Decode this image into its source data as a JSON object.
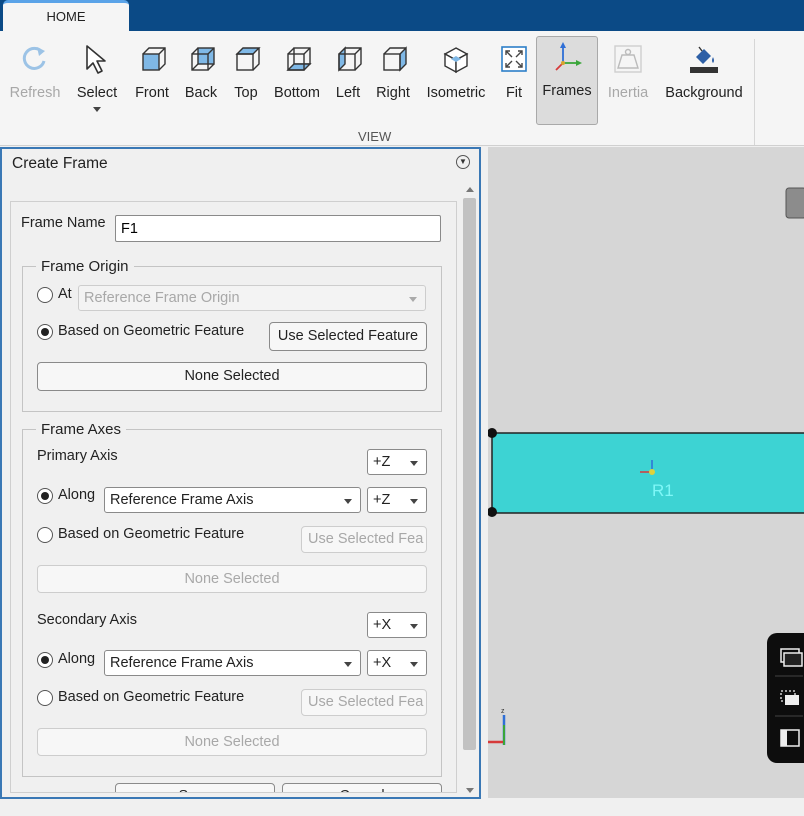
{
  "tabs": {
    "home": "HOME"
  },
  "ribbon": {
    "buttons": {
      "refresh": "Refresh",
      "select": "Select",
      "front": "Front",
      "back": "Back",
      "top": "Top",
      "bottom": "Bottom",
      "left": "Left",
      "right": "Right",
      "isometric": "Isometric",
      "fit": "Fit",
      "frames": "Frames",
      "inertia": "Inertia",
      "background": "Background"
    },
    "section_label": "VIEW"
  },
  "panel": {
    "title": "Create Frame",
    "frame_name_label": "Frame Name",
    "frame_name_value": "F1",
    "origin": {
      "legend": "Frame Origin",
      "at_label": "At",
      "at_dropdown": "Reference Frame Origin",
      "geo_label": "Based on Geometric Feature",
      "use_selected": "Use Selected Feature",
      "none_selected": "None Selected"
    },
    "axes": {
      "legend": "Frame Axes",
      "primary_label": "Primary Axis",
      "primary_axis_value": "+Z",
      "primary_along_label": "Along",
      "primary_along_dropdown": "Reference Frame Axis",
      "primary_along_axis": "+Z",
      "primary_geo_label": "Based on Geometric Feature",
      "primary_use_selected": "Use Selected Fea",
      "primary_none_selected": "None Selected",
      "secondary_label": "Secondary Axis",
      "secondary_axis_value": "+X",
      "secondary_along_label": "Along",
      "secondary_along_dropdown": "Reference Frame Axis",
      "secondary_along_axis": "+X",
      "secondary_geo_label": "Based on Geometric Feature",
      "secondary_use_selected": "Use Selected Fea",
      "secondary_none_selected": "None Selected"
    },
    "save": "Save",
    "cancel": "Cancel"
  },
  "viewport": {
    "frame_label": "R1",
    "triad_z": "z",
    "background_color": "#d6d6d6",
    "body_color": "#3dd3d3"
  }
}
